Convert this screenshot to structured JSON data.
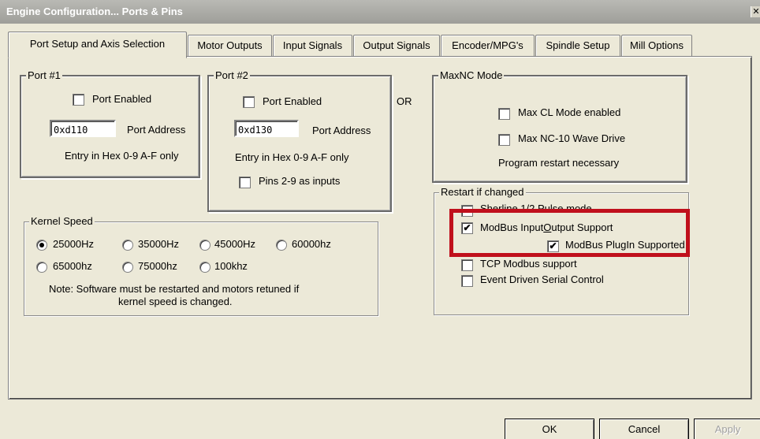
{
  "window": {
    "title": "Engine Configuration... Ports & Pins",
    "close_glyph": "✕"
  },
  "tabs": [
    {
      "label": "Port Setup and Axis Selection",
      "active": true
    },
    {
      "label": "Motor Outputs"
    },
    {
      "label": "Input Signals"
    },
    {
      "label": "Output Signals"
    },
    {
      "label": "Encoder/MPG's"
    },
    {
      "label": "Spindle Setup"
    },
    {
      "label": "Mill Options"
    }
  ],
  "port1": {
    "legend": "Port #1",
    "enabled_label": "Port Enabled",
    "enabled": false,
    "address_value": "0xd110",
    "address_label": "Port Address",
    "hint": "Entry in Hex 0-9 A-F only"
  },
  "port2": {
    "legend": "Port #2",
    "enabled_label": "Port Enabled",
    "enabled": false,
    "address_value": "0xd130",
    "address_label": "Port Address",
    "hint": "Entry in Hex 0-9 A-F only",
    "pins_inputs_label": "Pins 2-9 as inputs",
    "pins_inputs": false
  },
  "or_label": "OR",
  "maxnc": {
    "legend": "MaxNC Mode",
    "cl_mode_label": "Max CL Mode enabled",
    "cl_mode": false,
    "wave_drive_label": "Max NC-10 Wave Drive",
    "wave_drive": false,
    "restart_note": "Program restart necessary"
  },
  "restart": {
    "legend": "Restart if changed",
    "sherline_label": "Sherline 1/2 Pulse mode",
    "sherline": false,
    "modbus_io_label_pre": "ModBus Input",
    "modbus_io_label_underlined": "O",
    "modbus_io_label_post": "utput Support",
    "modbus_io": true,
    "modbus_plugin_label": "ModBus PlugIn Supported.",
    "modbus_plugin": true,
    "tcp_modbus_label": "TCP Modbus support",
    "tcp_modbus": false,
    "event_serial_label": "Event Driven Serial Control",
    "event_serial": false
  },
  "kernel": {
    "legend": "Kernel Speed",
    "options": [
      "25000Hz",
      "35000Hz",
      "45000Hz",
      "60000hz",
      "65000hz",
      "75000hz",
      "100khz"
    ],
    "selected": "25000Hz",
    "note_line1": "Note: Software must be restarted and motors retuned if",
    "note_line2": "kernel speed is changed."
  },
  "buttons": {
    "ok": "OK",
    "cancel": "Cancel",
    "apply": "Apply"
  },
  "colors": {
    "highlight": "#c0101c",
    "titlebar": "#a8a8a3",
    "face": "#ece9d8"
  },
  "icons": {
    "checkmark": "✔"
  }
}
